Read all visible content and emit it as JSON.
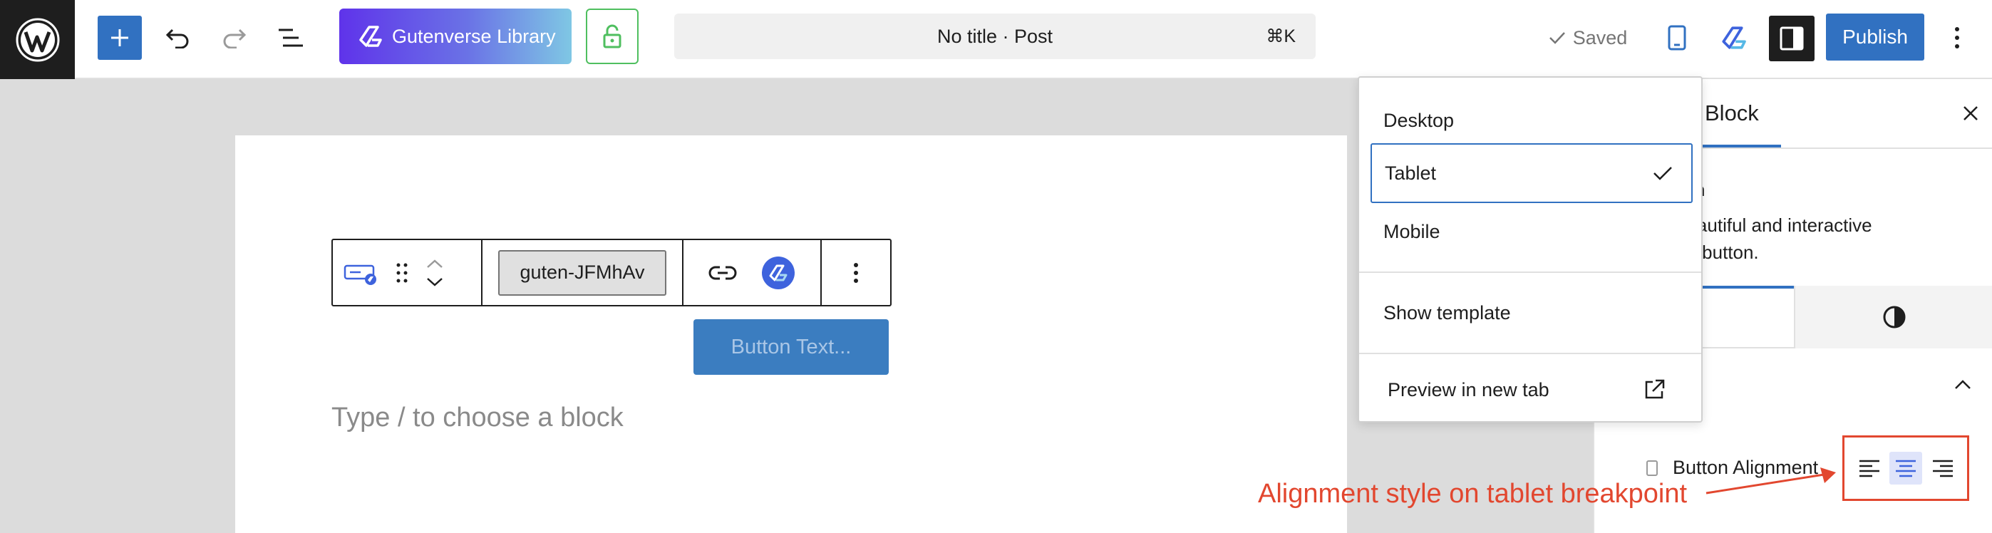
{
  "topbar": {
    "gutenverse_library_label": "Gutenverse Library",
    "command_title": "No title · Post",
    "command_shortcut": "⌘K",
    "saved_label": "Saved",
    "publish_label": "Publish"
  },
  "canvas": {
    "block_class": "guten-JFMhAv",
    "button_text": "Button Text...",
    "placeholder": "Type / to choose a block"
  },
  "preview_menu": {
    "items": [
      {
        "label": "Desktop",
        "selected": false
      },
      {
        "label": "Tablet",
        "selected": true
      },
      {
        "label": "Mobile",
        "selected": false
      }
    ],
    "show_template": "Show template",
    "preview_new_tab": "Preview in new tab"
  },
  "sidebar": {
    "tab_label": "Block",
    "block_title": "ton",
    "block_desc_line1": "beautiful and interactive",
    "block_desc_line2": "on button.",
    "alignment_label": "Button Alignment",
    "alignment_options": [
      "left",
      "center",
      "right"
    ],
    "alignment_selected": "center"
  },
  "annotation": {
    "text": "Alignment style on tablet breakpoint",
    "color": "#e2472f"
  },
  "colors": {
    "accent": "#3171c1",
    "dark": "#1e1e1e"
  }
}
